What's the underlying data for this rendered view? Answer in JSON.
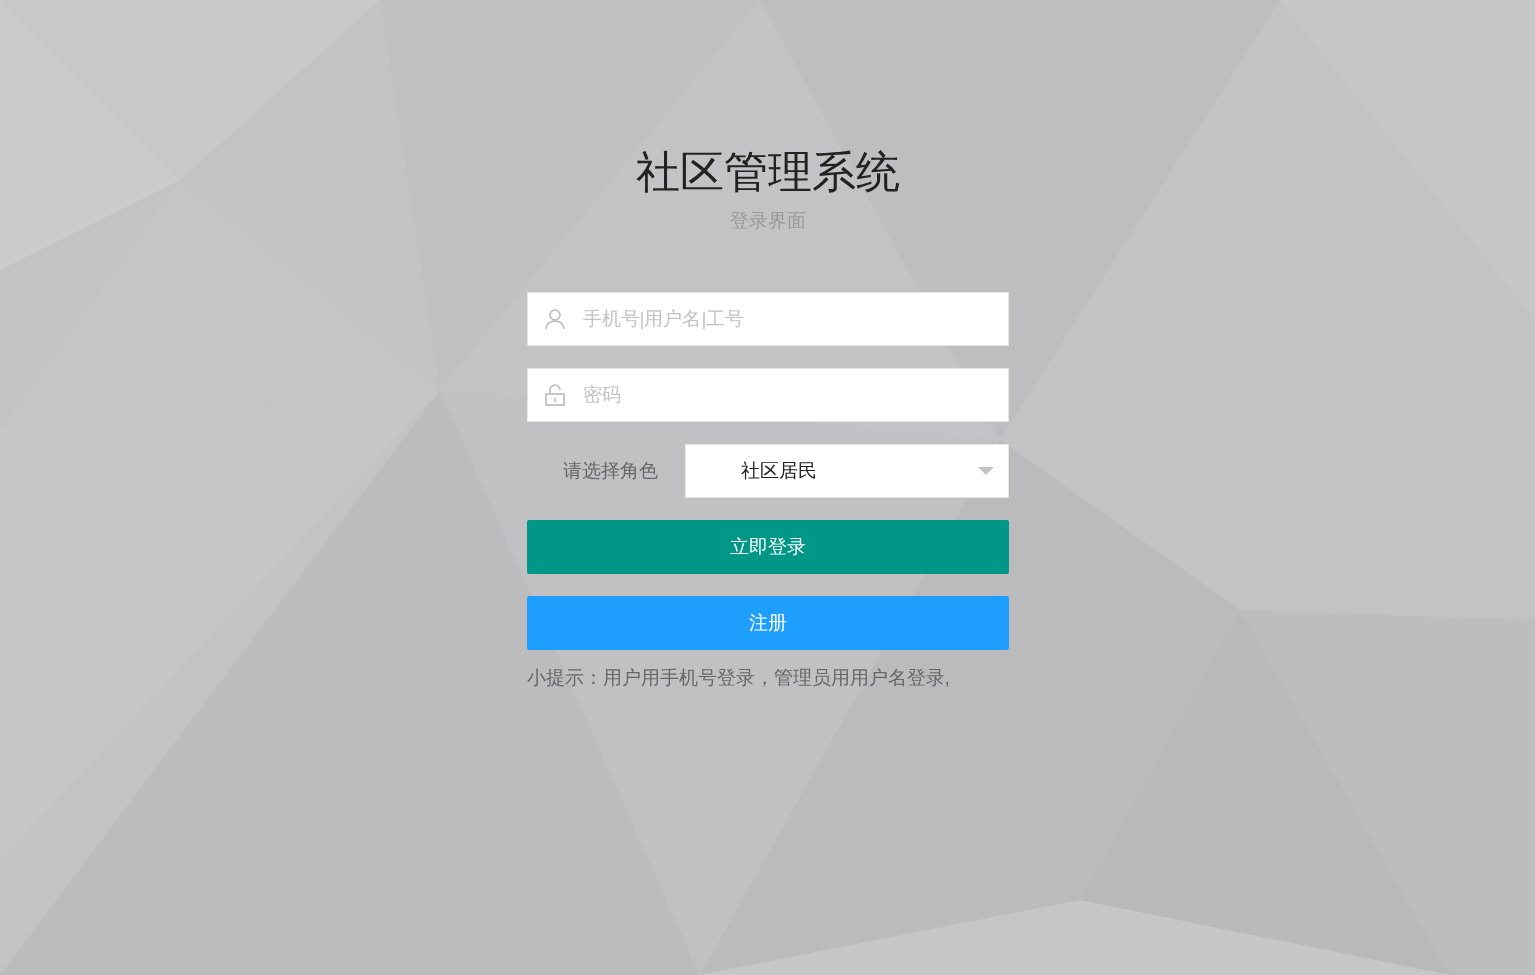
{
  "title": "社区管理系统",
  "subtitle": "登录界面",
  "fields": [
    {
      "kind": "user",
      "placeholder": "手机号|用户名|工号"
    },
    {
      "kind": "password",
      "placeholder": "密码"
    }
  ],
  "role": {
    "label": "请选择角色",
    "value": "社区居民"
  },
  "buttons": [
    {
      "kind": "primary",
      "label": "立即登录"
    },
    {
      "kind": "secondary",
      "label": "注册"
    }
  ],
  "hint": "小提示：用户用手机号登录，管理员用用户名登录,"
}
